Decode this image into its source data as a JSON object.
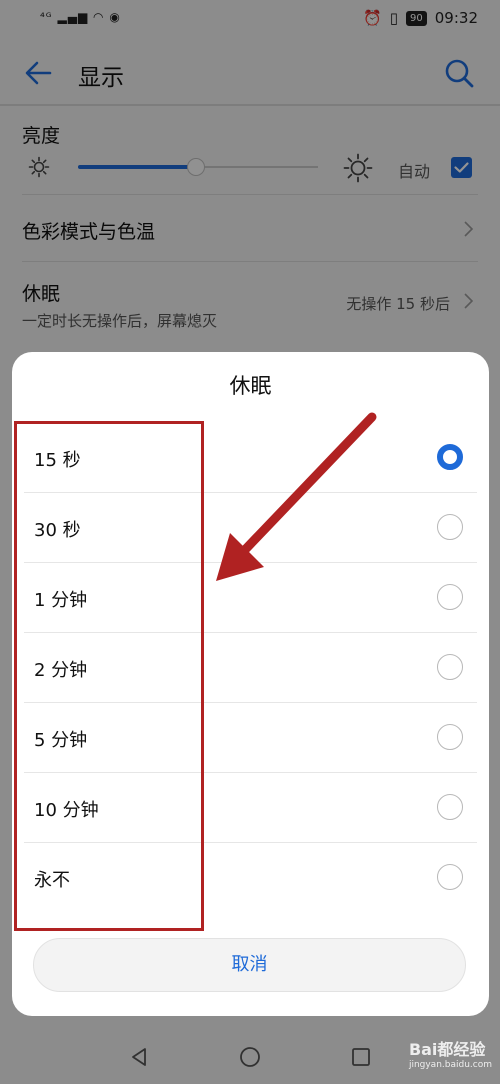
{
  "status_bar": {
    "signal_text": "⁴ᴳ",
    "battery": "90",
    "time": "09:32"
  },
  "app_bar": {
    "title": "显示"
  },
  "brightness": {
    "title": "亮度",
    "level": 0.49,
    "auto_label": "自动",
    "auto_checked": true
  },
  "settings": {
    "color_mode_title": "色彩模式与色温",
    "sleep_title": "休眠",
    "sleep_subtitle": "一定时长无操作后，屏幕熄灭",
    "sleep_value": "无操作 15 秒后"
  },
  "dialog": {
    "title": "休眠",
    "options": [
      {
        "label": "15 秒",
        "selected": true
      },
      {
        "label": "30 秒",
        "selected": false
      },
      {
        "label": "1 分钟",
        "selected": false
      },
      {
        "label": "2 分钟",
        "selected": false
      },
      {
        "label": "5 分钟",
        "selected": false
      },
      {
        "label": "10 分钟",
        "selected": false
      },
      {
        "label": "永不",
        "selected": false
      }
    ],
    "cancel_label": "取消"
  },
  "watermark": {
    "brand": "Bai都经验",
    "url": "jingyan.baidu.com"
  },
  "colors": {
    "accent": "#1e6ad8",
    "annotation": "#b02222"
  },
  "icons": {
    "back": "arrow-left-icon",
    "search": "search-icon",
    "brightness_low": "sun-small-icon",
    "brightness_high": "sun-large-icon",
    "chevron": "chevron-right-icon",
    "nav_back": "triangle-back-icon",
    "nav_home": "circle-home-icon",
    "nav_recent": "square-recent-icon"
  }
}
